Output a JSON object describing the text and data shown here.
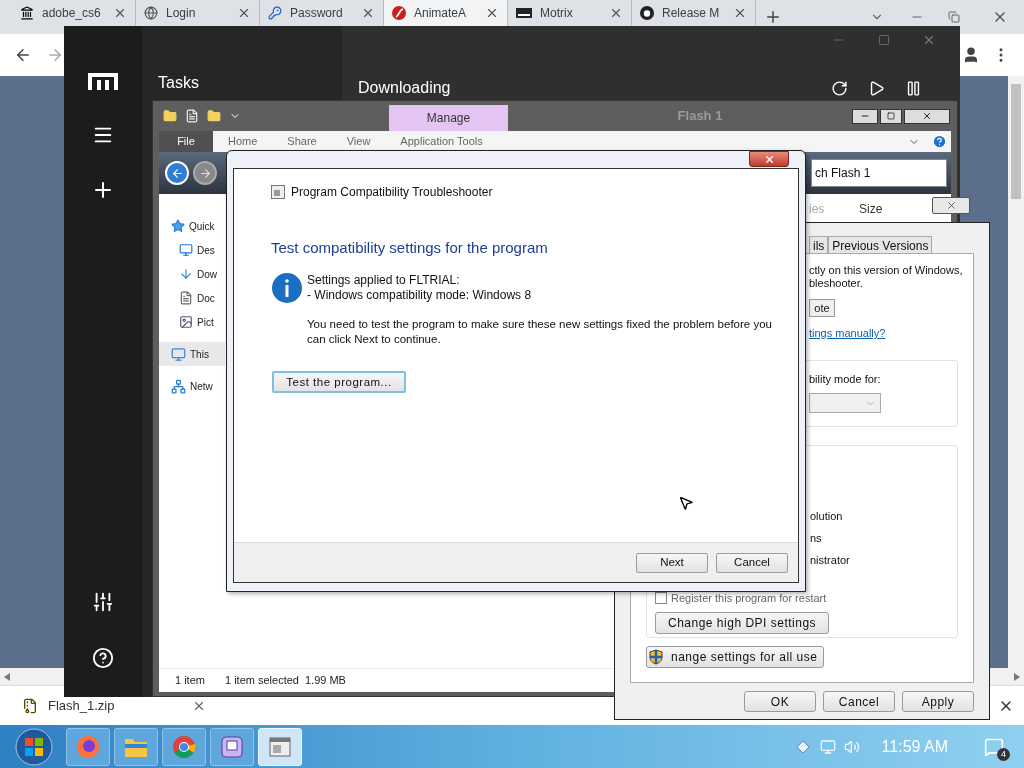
{
  "browser": {
    "tabs": [
      {
        "label": "adobe_cs6",
        "kind": "archive",
        "selected": false
      },
      {
        "label": "Login",
        "kind": "globe",
        "selected": false
      },
      {
        "label": "Password",
        "kind": "key",
        "selected": false
      },
      {
        "label": "AnimateA",
        "kind": "flash",
        "selected": true
      },
      {
        "label": "Motrix",
        "kind": "motrix",
        "selected": false
      },
      {
        "label": "Release M",
        "kind": "repo",
        "selected": false
      }
    ],
    "download": {
      "file": "Flash_1.zip"
    }
  },
  "motrix": {
    "nav_title": "Tasks",
    "main_title": "Downloading"
  },
  "explorer": {
    "title": "Flash 1",
    "context_tab": "Manage",
    "file_menu": "File",
    "ribbon_tabs": [
      "Home",
      "Share",
      "View",
      "Application Tools"
    ],
    "search_value": "ch Flash 1",
    "nav": [
      {
        "label": "Quick",
        "kind": "star",
        "selected": false,
        "children": [
          {
            "label": "Des",
            "kind": "desktop",
            "selected": false
          },
          {
            "label": "Dow",
            "kind": "download",
            "selected": false
          },
          {
            "label": "Doc",
            "kind": "document",
            "selected": false
          },
          {
            "label": "Pict",
            "kind": "pictures",
            "selected": false
          }
        ]
      },
      {
        "label": "This",
        "kind": "computer",
        "selected": true
      },
      {
        "label": "Netw",
        "kind": "network",
        "selected": false
      }
    ],
    "columns": [
      "ies",
      "Size"
    ],
    "status": {
      "count": "1 item",
      "selection": "1 item selected",
      "size": "1.99 MB"
    }
  },
  "properties": {
    "tabs": [
      {
        "label": "ils",
        "selected": false
      },
      {
        "label": "Previous Versions",
        "selected": false
      }
    ],
    "intro": [
      "ctly on this version of Windows,",
      "bleshooter."
    ],
    "run_button": "ote",
    "link": "tings manually?",
    "mode_label": "bility mode for:",
    "mode_dropdown": {
      "disabled": true
    },
    "settings": [
      "olution",
      "ns",
      "nistrator"
    ],
    "restart": {
      "label": "Register this program for restart",
      "checked": false
    },
    "dpi_button": "Change high DPI settings",
    "all_users_button": "nange settings for all use",
    "buttons": [
      "OK",
      "Cancel",
      "Apply"
    ]
  },
  "troubleshooter": {
    "app_title": "Program Compatibility Troubleshooter",
    "heading": "Test compatibility settings for the program",
    "applied": [
      "Settings applied to FLTRIAL:",
      "- Windows compatibility mode: Windows 8"
    ],
    "note": "You need to test the program to make sure these new settings fixed the problem before you can click Next to continue.",
    "test_button": "Test the program...",
    "buttons": [
      "Next",
      "Cancel"
    ]
  },
  "taskbar": {
    "apps": [
      {
        "kind": "firefox",
        "selected": false
      },
      {
        "kind": "explorer",
        "selected": false
      },
      {
        "kind": "chrome",
        "selected": false
      },
      {
        "kind": "floppy",
        "selected": false
      },
      {
        "kind": "troubleshooter",
        "selected": true
      }
    ],
    "time": "11:59 AM",
    "notifications": "4"
  }
}
